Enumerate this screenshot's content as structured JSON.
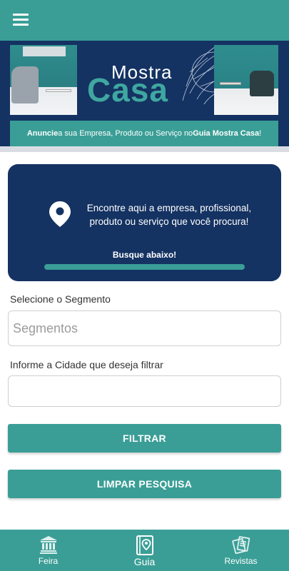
{
  "header": {
    "menu_icon": "hamburger-menu-icon"
  },
  "banner": {
    "brand_top": "Mostra",
    "brand_bottom": "Casa",
    "cta_bold_1": "Anuncie",
    "cta_text_1": " a sua Empresa, Produto ou Serviço no ",
    "cta_bold_2": "Guia Mostra Casa",
    "cta_text_2": "!"
  },
  "info_card": {
    "icon": "map-pin-icon",
    "text": "Encontre aqui a empresa, profissional, produto ou serviço que você procura!",
    "call_to_action": "Busque abaixo!",
    "progress": 1.0
  },
  "form": {
    "segment_label": "Selecione o Segmento",
    "segment_placeholder": "Segmentos",
    "segment_value": "",
    "city_label": "Informe a Cidade que deseja filtrar",
    "city_placeholder": "",
    "city_value": "",
    "filter_button": "FILTRAR",
    "clear_button": "LIMPAR PESQUISA"
  },
  "bottom_nav": {
    "items": [
      {
        "label": "Feira",
        "icon": "building-icon"
      },
      {
        "label": "Guia",
        "icon": "guide-book-pin-icon",
        "active": true
      },
      {
        "label": "Revistas",
        "icon": "magazines-icon"
      }
    ]
  },
  "colors": {
    "primary": "#3a9e96",
    "navy": "#143262",
    "white": "#ffffff"
  }
}
